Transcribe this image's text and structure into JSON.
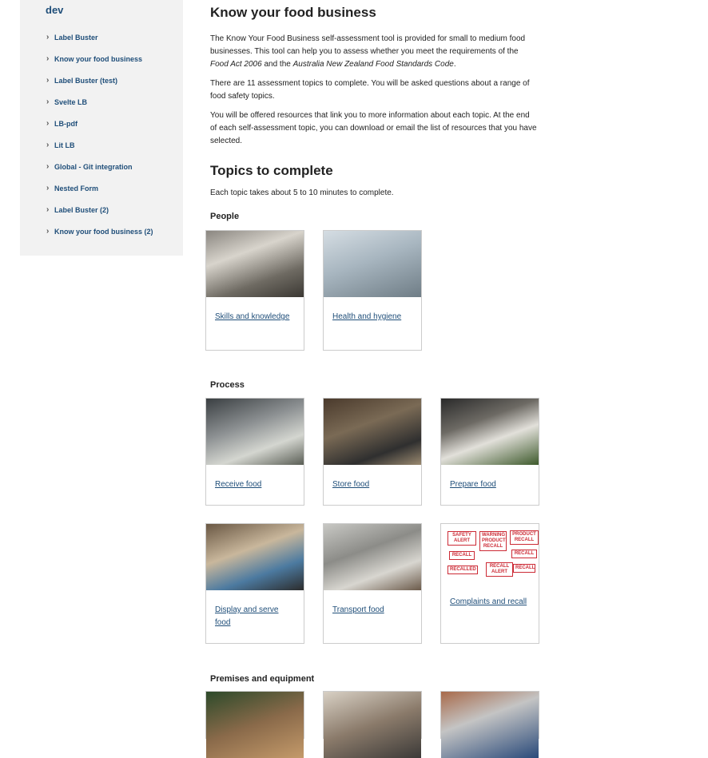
{
  "sidebar": {
    "title": "dev",
    "items": [
      {
        "label": "Label Buster"
      },
      {
        "label": "Know your food business"
      },
      {
        "label": "Label Buster (test)"
      },
      {
        "label": "Svelte LB"
      },
      {
        "label": "LB-pdf"
      },
      {
        "label": "Lit LB"
      },
      {
        "label": "Global - Git integration"
      },
      {
        "label": "Nested Form"
      },
      {
        "label": "Label Buster (2)"
      },
      {
        "label": "Know your food business (2)"
      }
    ]
  },
  "main": {
    "title": "Know your food business",
    "intro_1_a": "The Know Your Food Business self-assessment tool is provided for small to medium food businesses. This tool can help you to assess whether you meet the requirements of the ",
    "intro_1_act": "Food Act 2006",
    "intro_1_and": " and the ",
    "intro_1_code": "Australia New Zealand Food Standards Code",
    "intro_1_end": ".",
    "intro_2": "There are 11 assessment topics to complete. You will be asked questions about a range of food safety topics.",
    "intro_3": "You will be offered resources that link you to more information about each topic.  At the end of each self-assessment topic, you can download or email the list of resources that you have selected.",
    "topics_heading": "Topics to complete",
    "topics_intro": "Each topic takes about 5 to 10 minutes to complete.",
    "sections": {
      "people": {
        "title": "People",
        "cards": [
          {
            "label": "Skills and knowledge"
          },
          {
            "label": "Health and hygiene"
          }
        ]
      },
      "process": {
        "title": "Process",
        "cards": [
          {
            "label": "Receive food"
          },
          {
            "label": "Store food"
          },
          {
            "label": "Prepare food"
          },
          {
            "label": "Display and serve food"
          },
          {
            "label": "Transport food"
          },
          {
            "label": "Complaints and recall"
          }
        ]
      },
      "premises": {
        "title": "Premises and equipment"
      }
    },
    "recall_stamps": {
      "s1": "SAFETY ALERT",
      "s2": "WARNING PRODUCT RECALL",
      "s3": "PRODUCT RECALL",
      "s4": "RECALL",
      "s5": "RECALL",
      "s6": "RECALLED",
      "s7": "RECALL ALERT",
      "s8": "RECALL"
    }
  }
}
